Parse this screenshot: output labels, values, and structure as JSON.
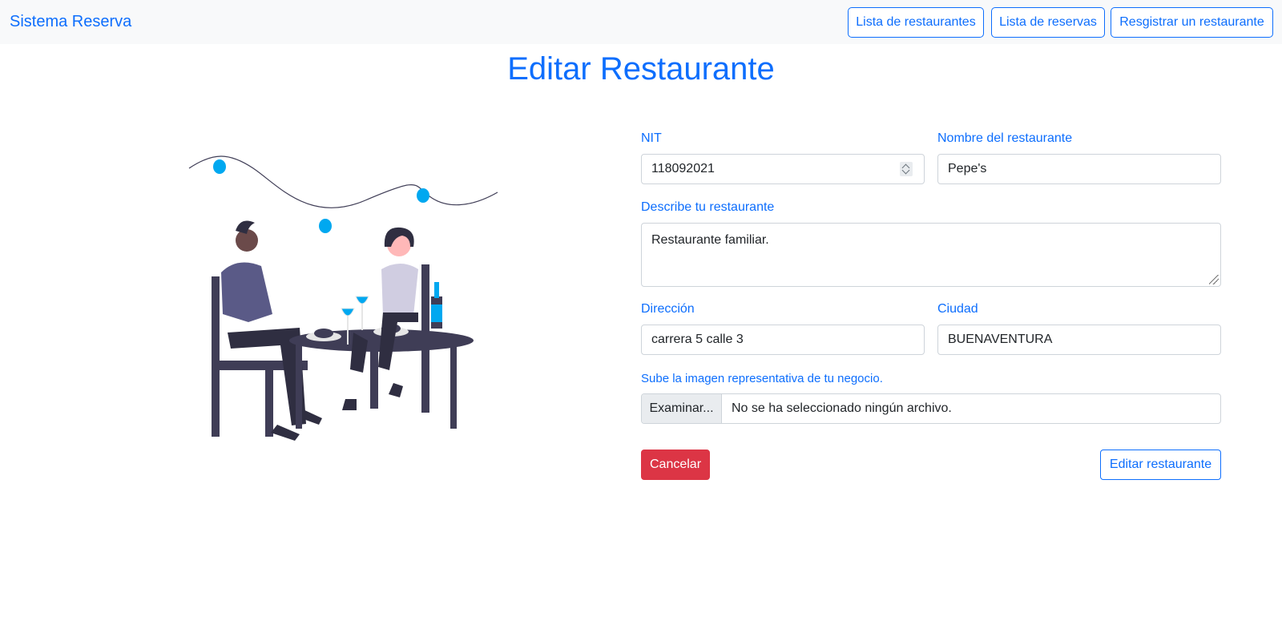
{
  "navbar": {
    "brand": "Sistema Reserva",
    "links": [
      {
        "label": "Lista de restaurantes"
      },
      {
        "label": "Lista de reservas"
      },
      {
        "label": "Resgistrar un restaurante"
      }
    ]
  },
  "page": {
    "title": "Editar Restaurante"
  },
  "form": {
    "nit": {
      "label": "NIT",
      "value": "118092021"
    },
    "name": {
      "label": "Nombre del restaurante",
      "value": "Pepe's"
    },
    "description": {
      "label": "Describe tu restaurante",
      "value": "Restaurante familiar."
    },
    "address": {
      "label": "Dirección",
      "value": "carrera 5 calle 3"
    },
    "city": {
      "label": "Ciudad",
      "value": "BUENAVENTURA"
    },
    "image": {
      "label": "Sube la imagen representativa de tu negocio.",
      "button": "Examinar...",
      "status": "No se ha seleccionado ningún archivo."
    },
    "cancel_label": "Cancelar",
    "submit_label": "Editar restaurante"
  },
  "colors": {
    "primary": "#0d6efd",
    "danger": "#dc3545",
    "navbar_bg": "#f8f9fa",
    "accent_light_blue": "#00a8f0",
    "illustration_dark": "#3f3d56"
  },
  "illustration": {
    "description_icon": "couple-dining-illustration"
  }
}
